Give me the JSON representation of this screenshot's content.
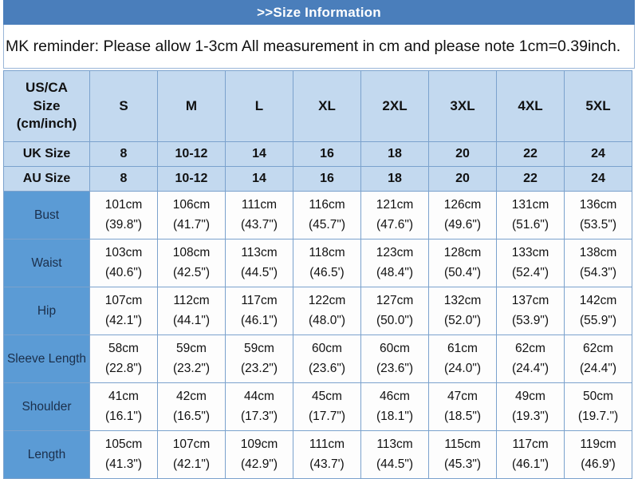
{
  "header": {
    "title": ">>Size Information"
  },
  "reminder": {
    "text": "MK reminder: Please allow 1-3cm All measurement in cm and please note 1cm=0.39inch."
  },
  "table": {
    "corner_label": "US/CA Size (cm/inch)",
    "corner_line1": "US/CA",
    "corner_line2": "Size",
    "corner_line3": "(cm/inch)",
    "size_columns": [
      "S",
      "M",
      "L",
      "XL",
      "2XL",
      "3XL",
      "4XL",
      "5XL"
    ],
    "sub_rows": [
      {
        "label": "UK Size",
        "values": [
          "8",
          "10-12",
          "14",
          "16",
          "18",
          "20",
          "22",
          "24"
        ]
      },
      {
        "label": "AU Size",
        "values": [
          "8",
          "10-12",
          "14",
          "16",
          "18",
          "20",
          "22",
          "24"
        ]
      }
    ],
    "measurement_rows": [
      {
        "label": "Bust",
        "cm": [
          "101cm",
          "106cm",
          "111cm",
          "116cm",
          "121cm",
          "126cm",
          "131cm",
          "136cm"
        ],
        "inch": [
          "(39.8\")",
          "(41.7\")",
          "(43.7\")",
          "(45.7\")",
          "(47.6\")",
          "(49.6\")",
          "(51.6\")",
          "(53.5\")"
        ]
      },
      {
        "label": "Waist",
        "cm": [
          "103cm",
          "108cm",
          "113cm",
          "118cm",
          "123cm",
          "128cm",
          "133cm",
          "138cm"
        ],
        "inch": [
          "(40.6\")",
          "(42.5\")",
          "(44.5\")",
          "(46.5')",
          "(48.4\")",
          "(50.4\")",
          "(52.4\")",
          "(54.3\")"
        ]
      },
      {
        "label": "Hip",
        "cm": [
          "107cm",
          "112cm",
          "117cm",
          "122cm",
          "127cm",
          "132cm",
          "137cm",
          "142cm"
        ],
        "inch": [
          "(42.1\")",
          "(44.1\")",
          "(46.1\")",
          "(48.0\")",
          "(50.0\")",
          "(52.0\")",
          "(53.9\")",
          "(55.9\")"
        ]
      },
      {
        "label": "Sleeve Length",
        "cm": [
          "58cm",
          "59cm",
          "59cm",
          "60cm",
          "60cm",
          "61cm",
          "62cm",
          "62cm"
        ],
        "inch": [
          "(22.8\")",
          "(23.2\")",
          "(23.2\")",
          "(23.6\")",
          "(23.6\")",
          "(24.0\")",
          "(24.4\")",
          "(24.4\")"
        ]
      },
      {
        "label": "Shoulder",
        "cm": [
          "41cm",
          "42cm",
          "44cm",
          "45cm",
          "46cm",
          "47cm",
          "49cm",
          "50cm"
        ],
        "inch": [
          "(16.1\")",
          "(16.5\")",
          "(17.3\")",
          "(17.7\")",
          "(18.1\")",
          "(18.5\")",
          "(19.3\")",
          "(19.7.\")"
        ]
      },
      {
        "label": "Length",
        "cm": [
          "105cm",
          "107cm",
          "109cm",
          "111cm",
          "113cm",
          "115cm",
          "117cm",
          "119cm"
        ],
        "inch": [
          "(41.3\")",
          "(42.1\")",
          "(42.9\")",
          "(43.7')",
          "(44.5\")",
          "(45.3\")",
          "(46.1\")",
          "(46.9')"
        ]
      }
    ]
  }
}
